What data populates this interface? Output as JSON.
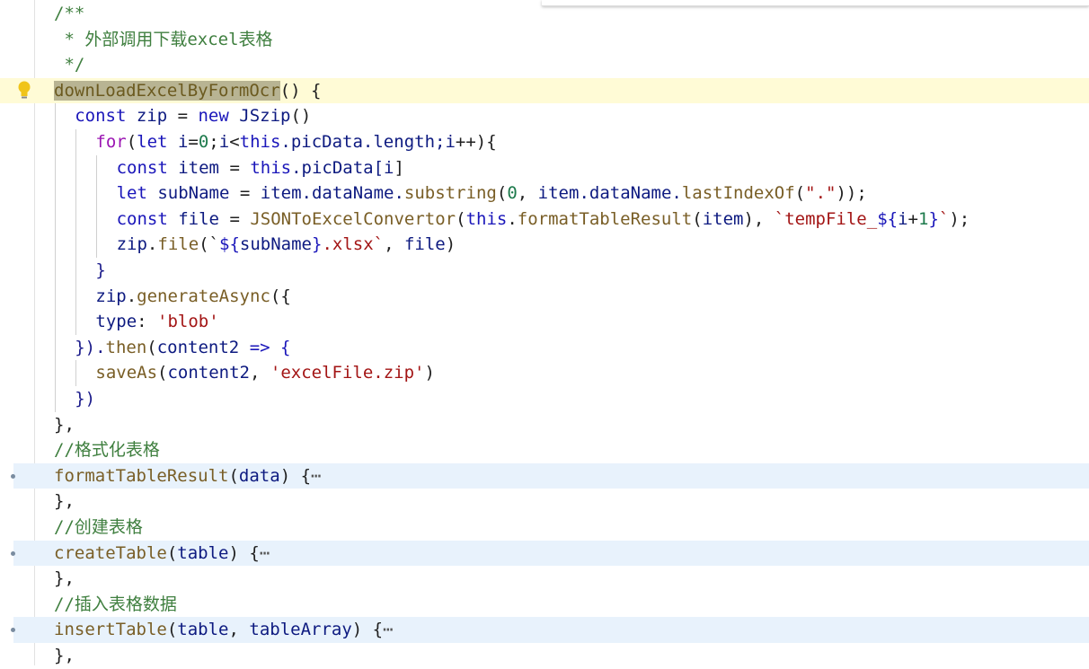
{
  "editor": {
    "lines": [
      {
        "indent": 0,
        "parts": [
          [
            "/**",
            "comment"
          ]
        ]
      },
      {
        "indent": 0,
        "parts": [
          [
            " * 外部调用下载excel表格",
            "comment"
          ]
        ]
      },
      {
        "indent": 0,
        "parts": [
          [
            " */",
            "comment"
          ]
        ]
      },
      {
        "indent": 0,
        "current": true,
        "parts": [
          [
            "downLoadExcelByFormOcr",
            "hlword"
          ],
          [
            "() {",
            "plain"
          ]
        ]
      },
      {
        "indent": 1,
        "parts": [
          [
            "const ",
            "kw"
          ],
          [
            "zip",
            "var"
          ],
          [
            " = ",
            "plain"
          ],
          [
            "new ",
            "kw"
          ],
          [
            "JSzip",
            "var"
          ],
          [
            "()",
            "plain"
          ]
        ]
      },
      {
        "indent": 2,
        "parts": [
          [
            "for",
            "ctrl"
          ],
          [
            "(",
            "plain"
          ],
          [
            "let ",
            "kw"
          ],
          [
            "i",
            "var"
          ],
          [
            "=",
            "plain"
          ],
          [
            "0",
            "num"
          ],
          [
            ";",
            "plain"
          ],
          [
            "i",
            "var"
          ],
          [
            "<",
            "plain"
          ],
          [
            "this",
            "kw"
          ],
          [
            ".picData.length;",
            "var"
          ],
          [
            "i",
            "var"
          ],
          [
            "++){",
            "plain"
          ]
        ]
      },
      {
        "indent": 3,
        "parts": [
          [
            "const ",
            "kw"
          ],
          [
            "item",
            "var"
          ],
          [
            " = ",
            "plain"
          ],
          [
            "this",
            "kw"
          ],
          [
            ".picData[",
            "var"
          ],
          [
            "i",
            "var"
          ],
          [
            "]",
            "plain"
          ]
        ]
      },
      {
        "indent": 3,
        "parts": [
          [
            "let ",
            "kw"
          ],
          [
            "subName",
            "var"
          ],
          [
            " = ",
            "plain"
          ],
          [
            "item",
            "var"
          ],
          [
            ".dataName.",
            "var"
          ],
          [
            "substring",
            "fn"
          ],
          [
            "(",
            "plain"
          ],
          [
            "0",
            "num"
          ],
          [
            ", ",
            "plain"
          ],
          [
            "item",
            "var"
          ],
          [
            ".dataName.",
            "var"
          ],
          [
            "lastIndexOf",
            "fn"
          ],
          [
            "(",
            "plain"
          ],
          [
            "\".\"",
            "str"
          ],
          [
            "));",
            "plain"
          ]
        ]
      },
      {
        "indent": 3,
        "parts": [
          [
            "const ",
            "kw"
          ],
          [
            "file",
            "var"
          ],
          [
            " = ",
            "plain"
          ],
          [
            "JSONToExcelConvertor",
            "fn"
          ],
          [
            "(",
            "plain"
          ],
          [
            "this",
            "kw"
          ],
          [
            ".",
            "plain"
          ],
          [
            "formatTableResult",
            "fn"
          ],
          [
            "(",
            "plain"
          ],
          [
            "item",
            "var"
          ],
          [
            "), ",
            "plain"
          ],
          [
            "`tempFile_",
            "str"
          ],
          [
            "${",
            "kw"
          ],
          [
            "i",
            "var"
          ],
          [
            "+",
            "plain"
          ],
          [
            "1",
            "num"
          ],
          [
            "}",
            "kw"
          ],
          [
            "`",
            "str"
          ],
          [
            ");",
            "plain"
          ]
        ]
      },
      {
        "indent": 3,
        "parts": [
          [
            "zip",
            "var"
          ],
          [
            ".",
            "plain"
          ],
          [
            "file",
            "fn"
          ],
          [
            "(`",
            "plain"
          ],
          [
            "${",
            "kw"
          ],
          [
            "subName",
            "var"
          ],
          [
            "}",
            "kw"
          ],
          [
            ".xlsx`",
            "str"
          ],
          [
            ", ",
            "plain"
          ],
          [
            "file",
            "var"
          ],
          [
            ")",
            "plain"
          ]
        ]
      },
      {
        "indent": 2,
        "parts": [
          [
            "}",
            "brace"
          ]
        ]
      },
      {
        "indent": 2,
        "parts": [
          [
            "zip",
            "var"
          ],
          [
            ".",
            "plain"
          ],
          [
            "generateAsync",
            "fn"
          ],
          [
            "({",
            "plain"
          ]
        ]
      },
      {
        "indent": 2,
        "parts": [
          [
            "type",
            "var"
          ],
          [
            ": ",
            "plain"
          ],
          [
            "'blob'",
            "str"
          ]
        ]
      },
      {
        "indent": 1,
        "parts": [
          [
            "}).",
            "brace"
          ],
          [
            "then",
            "fn"
          ],
          [
            "(",
            "plain"
          ],
          [
            "content2",
            "var"
          ],
          [
            " => {",
            "kw"
          ]
        ]
      },
      {
        "indent": 2,
        "parts": [
          [
            "saveAs",
            "fn"
          ],
          [
            "(",
            "plain"
          ],
          [
            "content2",
            "var"
          ],
          [
            ", ",
            "plain"
          ],
          [
            "'excelFile.zip'",
            "str"
          ],
          [
            ")",
            "plain"
          ]
        ]
      },
      {
        "indent": 1,
        "parts": [
          [
            "})",
            "brace"
          ]
        ]
      },
      {
        "indent": 0,
        "parts": [
          [
            "},",
            "plain"
          ]
        ]
      },
      {
        "indent": 0,
        "parts": [
          [
            "//格式化表格",
            "comment"
          ]
        ]
      },
      {
        "indent": 0,
        "folded": true,
        "parts": [
          [
            "formatTableResult",
            "fn"
          ],
          [
            "(",
            "plain"
          ],
          [
            "data",
            "var"
          ],
          [
            ") {",
            "plain"
          ],
          [
            "⋯",
            "ellipsis"
          ]
        ]
      },
      {
        "indent": 0,
        "parts": [
          [
            "},",
            "plain"
          ]
        ]
      },
      {
        "indent": 0,
        "parts": [
          [
            "//创建表格",
            "comment"
          ]
        ]
      },
      {
        "indent": 0,
        "folded": true,
        "parts": [
          [
            "createTable",
            "fn"
          ],
          [
            "(",
            "plain"
          ],
          [
            "table",
            "var"
          ],
          [
            ") {",
            "plain"
          ],
          [
            "⋯",
            "ellipsis"
          ]
        ]
      },
      {
        "indent": 0,
        "parts": [
          [
            "},",
            "plain"
          ]
        ]
      },
      {
        "indent": 0,
        "parts": [
          [
            "//插入表格数据",
            "comment"
          ]
        ]
      },
      {
        "indent": 0,
        "folded": true,
        "parts": [
          [
            "insertTable",
            "fn"
          ],
          [
            "(",
            "plain"
          ],
          [
            "table",
            "var"
          ],
          [
            ", ",
            "plain"
          ],
          [
            "tableArray",
            "var"
          ],
          [
            ") {",
            "plain"
          ],
          [
            "⋯",
            "ellipsis"
          ]
        ]
      },
      {
        "indent": 0,
        "parts": [
          [
            "},",
            "plain"
          ]
        ]
      }
    ]
  },
  "icons": {
    "lightbulb": "lightbulb-icon",
    "fold": "fold-collapsed-icon",
    "ellipsis": "folded-code-ellipsis"
  },
  "colors": {
    "current_line": "#fffbd6",
    "folded_line": "#e8f2fc",
    "comment": "#3f7f3f",
    "keyword": "#1a16ba",
    "string": "#a31515"
  }
}
